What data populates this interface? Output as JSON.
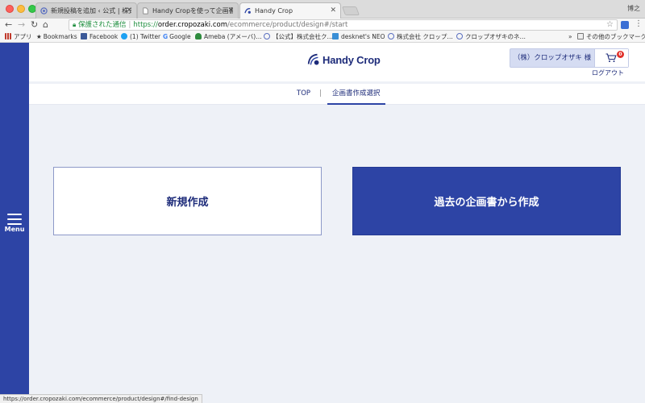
{
  "browser": {
    "tabs": [
      {
        "title": "新規投稿を追加 ‹ 公式 | 株式会社",
        "active": false
      },
      {
        "title": "Handy Cropを使って企画書を作",
        "active": false
      },
      {
        "title": "Handy Crop",
        "active": true
      }
    ],
    "profile_name": "博之",
    "address": {
      "secure_label": "保護された通信",
      "scheme": "https://",
      "host": "order.cropozaki.com",
      "path": "/ecommerce/product/design#/start"
    },
    "bookmarks": [
      {
        "label": "アプリ",
        "icon": "apps-grid-icon",
        "color": "#c0392b"
      },
      {
        "label": "Bookmarks",
        "icon": "star-icon",
        "color": "#555555"
      },
      {
        "label": "Facebook",
        "icon": "facebook-icon",
        "color": "#3b5998"
      },
      {
        "label": "(1) Twitter",
        "icon": "twitter-icon",
        "color": "#1da1f2"
      },
      {
        "label": "Google",
        "icon": "google-icon",
        "color": "#4285f4"
      },
      {
        "label": "Ameba (アメーバ)…",
        "icon": "ameba-icon",
        "color": "#2e8b3e"
      },
      {
        "label": "【公式】株式会社ク…",
        "icon": "crop-site-icon",
        "color": "#5a6fc0"
      },
      {
        "label": "desknet's NEO",
        "icon": "desknets-icon",
        "color": "#3a8fd6"
      },
      {
        "label": "株式会社 クロップ…",
        "icon": "crop-site-icon",
        "color": "#5a6fc0"
      },
      {
        "label": "クロップオザキのネ…",
        "icon": "crop-site-icon",
        "color": "#5a6fc0"
      }
    ],
    "bookmarks_overflow": "»",
    "other_bookmarks": "その他のブックマーク",
    "status_url": "https://order.cropozaki.com/ecommerce/product/design#/find-design"
  },
  "app": {
    "menu_label": "Menu",
    "logo_text": "Handy Crop",
    "user_name": "（株）クロップオザキ 様",
    "cart_count": "0",
    "logout_label": "ログアウト",
    "nav": {
      "top_label": "TOP",
      "divider": "|",
      "current_label": "企画書作成選択"
    },
    "choices": {
      "new_label": "新規作成",
      "past_label": "過去の企画書から作成"
    },
    "colors": {
      "brand_blue": "#2d44a5",
      "brand_navy": "#1e2c7a",
      "badge_red": "#e0312b",
      "page_bg": "#eef1f7"
    }
  }
}
